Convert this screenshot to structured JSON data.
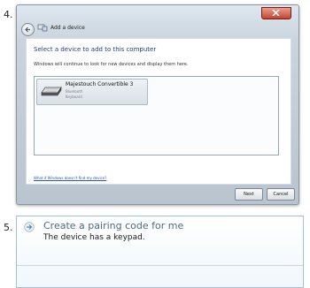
{
  "steps": {
    "step4_label": "4.",
    "step5_label": "5."
  },
  "dialog": {
    "title": "Add a device",
    "heading": "Select a device to add to this computer",
    "subtext": "Windows will continue to look for new devices and display them here.",
    "devices": [
      {
        "name": "Majestouch Convertible 3",
        "type": "Bluetooth",
        "category": "Keyboard",
        "icon": "keyboard-icon"
      }
    ],
    "help_link": "What if Windows doesn't find my device?",
    "next_label": "Next",
    "cancel_label": "Cancel"
  },
  "pairing_option": {
    "title": "Create a pairing code for me",
    "description": "The device has a keypad.",
    "icon": "arrow-right-icon"
  },
  "colors": {
    "heading_blue": "#1e3f8a",
    "link_blue": "#2a56b8",
    "close_red": "#c2452e"
  }
}
